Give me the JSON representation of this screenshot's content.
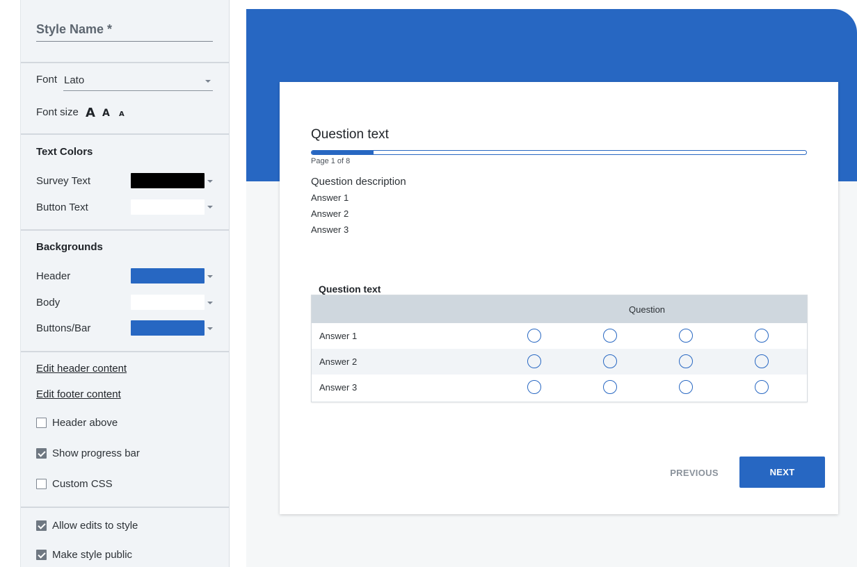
{
  "panel": {
    "style_name_placeholder": "Style Name *",
    "font_label": "Font",
    "font_value": "Lato",
    "font_size_label": "Font size",
    "font_size_options": [
      "A",
      "A",
      "A"
    ],
    "text_colors": {
      "heading": "Text Colors",
      "items": [
        {
          "label": "Survey Text",
          "color": "#000000"
        },
        {
          "label": "Button Text",
          "color": "#ffffff"
        }
      ]
    },
    "backgrounds": {
      "heading": "Backgrounds",
      "items": [
        {
          "label": "Header",
          "color": "#2767c2"
        },
        {
          "label": "Body",
          "color": "#ffffff"
        },
        {
          "label": "Buttons/Bar",
          "color": "#2767c2"
        }
      ]
    },
    "links": {
      "edit_header": "Edit header content",
      "edit_footer": "Edit footer content"
    },
    "options": [
      {
        "label": "Header above",
        "checked": false
      },
      {
        "label": "Show progress bar",
        "checked": true
      },
      {
        "label": "Custom CSS",
        "checked": false
      }
    ],
    "sharing": [
      {
        "label": "Allow edits to style",
        "checked": true
      },
      {
        "label": "Make style public",
        "checked": true
      }
    ]
  },
  "preview": {
    "question_title": "Question text",
    "progress_fraction": 0.125,
    "page_indicator": "Page 1 of 8",
    "question_description": "Question description",
    "answers": [
      "Answer 1",
      "Answer 2",
      "Answer 3"
    ],
    "matrix": {
      "title": "Question text",
      "column_header": "Question",
      "rows": [
        "Answer 1",
        "Answer 2",
        "Answer 3"
      ],
      "radio_columns": 4
    },
    "buttons": {
      "previous": "PREVIOUS",
      "next": "NEXT"
    }
  },
  "colors": {
    "accent": "#2767c2",
    "panel_bg": "#f1f4f7",
    "matrix_header_bg": "#cfd7de"
  }
}
